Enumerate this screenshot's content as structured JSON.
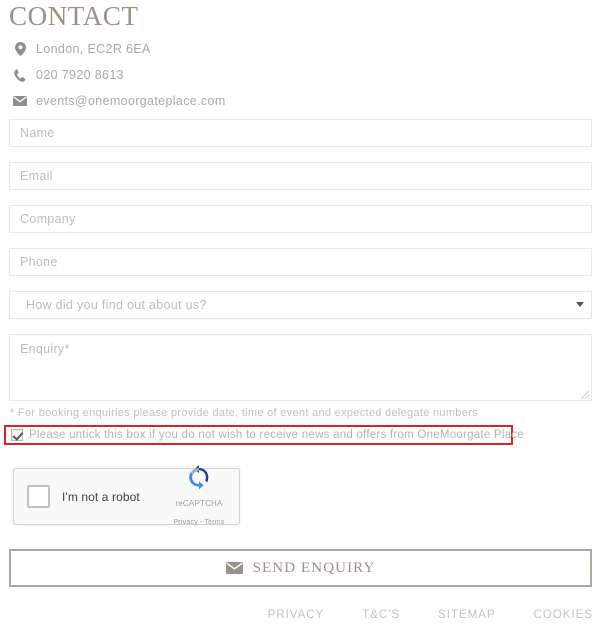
{
  "heading": "CONTACT",
  "contact": {
    "items": [
      {
        "icon": "map-pin-icon",
        "text": "London, EC2R 6EA"
      },
      {
        "icon": "phone-icon",
        "text": "020 7920 8613"
      },
      {
        "icon": "envelope-icon",
        "text": "events@onemoorgateplace.com"
      }
    ]
  },
  "form": {
    "name_placeholder": "Name",
    "email_placeholder": "Email",
    "company_placeholder": "Company",
    "phone_placeholder": "Phone",
    "referral_selected": "How did you find out about us?",
    "enquiry_placeholder": "Enquiry*",
    "footnote": "* For booking enquiries please provide date, time of event and expected delegate numbers",
    "consent_label": "Please untick this box if you do not wish to receive news and offers from OneMoorgate Place",
    "consent_checked": true
  },
  "recaptcha": {
    "label": "I'm not a robot",
    "brand": "reCAPTCHA",
    "legal": "Privacy - Terms"
  },
  "submit": {
    "label": "SEND ENQUIRY",
    "icon": "envelope-icon"
  },
  "footer": {
    "links": [
      "PRIVACY",
      "T&C'S",
      "SITEMAP",
      "COOKIES"
    ]
  },
  "colors": {
    "heading": "#9b9187",
    "accent_border": "#b0a99f",
    "alert_border": "#e02020",
    "placeholder": "#bdbdbd",
    "muted_text": "#c4c4c4"
  }
}
